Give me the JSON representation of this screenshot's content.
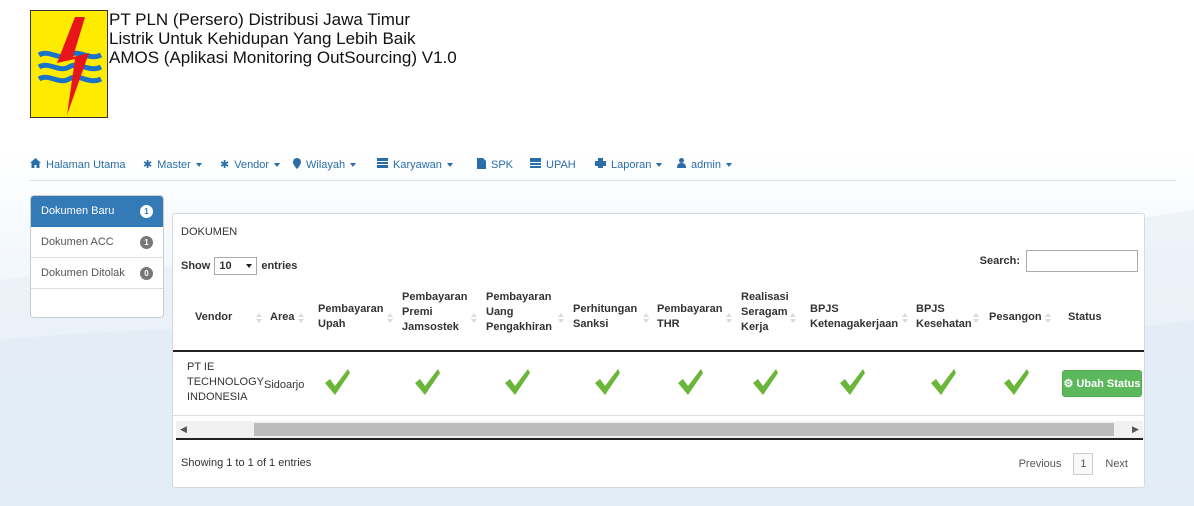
{
  "header": {
    "line1": "PT PLN (Persero) Distribusi Jawa Timur",
    "line2": "Listrik Untuk Kehidupan Yang Lebih Baik",
    "line3": "AMOS (Aplikasi Monitoring OutSourcing) V1.0"
  },
  "nav": {
    "home": "Halaman Utama",
    "master": "Master",
    "vendor": "Vendor",
    "wilayah": "Wilayah",
    "karyawan": "Karyawan",
    "spk": "SPK",
    "upah": "UPAH",
    "laporan": "Laporan",
    "admin": "admin"
  },
  "sidebar": {
    "items": [
      {
        "label": "Dokumen Baru",
        "count": "1"
      },
      {
        "label": "Dokumen ACC",
        "count": "1"
      },
      {
        "label": "Dokumen Ditolak",
        "count": "0"
      }
    ]
  },
  "panel": {
    "title": "DOKUMEN",
    "show_label": "Show",
    "entries_value": "10",
    "entries_label": "entries",
    "search_label": "Search:",
    "search_value": ""
  },
  "table": {
    "headers": {
      "vendor": "Vendor",
      "area": "Area",
      "upah_l1": "Pembayaran",
      "upah_l2": "Upah",
      "jam_l1": "Pembayaran",
      "jam_l2": "Premi",
      "jam_l3": "Jamsostek",
      "peng_l1": "Pembayaran",
      "peng_l2": "Uang",
      "peng_l3": "Pengakhiran",
      "sank_l1": "Perhitungan",
      "sank_l2": "Sanksi",
      "thr_l1": "Pembayaran",
      "thr_l2": "THR",
      "ser_l1": "Realisasi",
      "ser_l2": "Seragam",
      "ser_l3": "Kerja",
      "bpk_l1": "BPJS",
      "bpk_l2": "Ketenagakerjaan",
      "bpkes_l1": "BPJS",
      "bpkes_l2": "Kesehatan",
      "pesangon": "Pesangon",
      "status": "Status"
    },
    "row": {
      "vendor_l1": "PT IE",
      "vendor_l2": "TECHNOLOGY",
      "vendor_l3": "INDONESIA",
      "area": "Sidoarjo",
      "status_button": "Ubah Status"
    }
  },
  "footer": {
    "info": "Showing 1 to 1 of 1 entries",
    "previous": "Previous",
    "page": "1",
    "next": "Next"
  },
  "colors": {
    "link": "#2a6ea8",
    "active": "#337ab7",
    "success": "#5cb85c",
    "check": "#6ab63a"
  }
}
